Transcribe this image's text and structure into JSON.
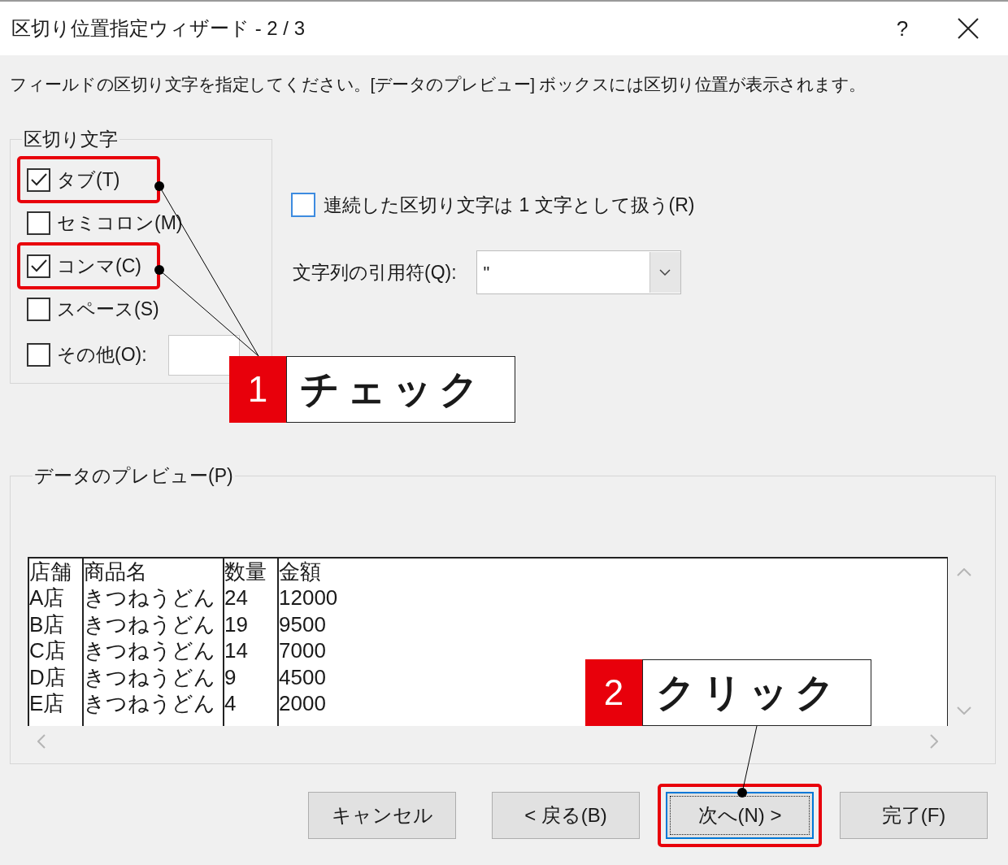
{
  "window": {
    "title": "区切り位置指定ウィザード - 2 / 3",
    "help": "?"
  },
  "instruction": "フィールドの区切り文字を指定してください。[データのプレビュー] ボックスには区切り位置が表示されます。",
  "delimiters": {
    "label": "区切り文字",
    "items": [
      {
        "label": "タブ(T)",
        "checked": true,
        "highlighted": true,
        "kind": "plain"
      },
      {
        "label": "セミコロン(M)",
        "checked": false,
        "highlighted": false,
        "kind": "plain"
      },
      {
        "label": "コンマ(C)",
        "checked": true,
        "highlighted": true,
        "kind": "plain"
      },
      {
        "label": "スペース(S)",
        "checked": false,
        "highlighted": false,
        "kind": "plain"
      },
      {
        "label": "その他(O):",
        "checked": false,
        "highlighted": false,
        "kind": "with_field"
      }
    ]
  },
  "options": {
    "consecutive": {
      "label": "連続した区切り文字は 1 文字として扱う(R)",
      "checked": false
    },
    "quote": {
      "label": "文字列の引用符(Q):",
      "value": "\""
    }
  },
  "preview": {
    "label": "データのプレビュー(P)",
    "rows": [
      [
        "店舗",
        "商品名",
        "数量",
        "金額"
      ],
      [
        "A店",
        "きつねうどん",
        "24",
        "12000"
      ],
      [
        "B店",
        "きつねうどん",
        "19",
        "9500"
      ],
      [
        "C店",
        "きつねうどん",
        "14",
        "7000"
      ],
      [
        "D店",
        "きつねうどん",
        "9",
        "4500"
      ],
      [
        "E店",
        "きつねうどん",
        "4",
        "2000"
      ]
    ]
  },
  "buttons": [
    {
      "label": "キャンセル",
      "highlighted": false,
      "focused": false
    },
    {
      "label": "< 戻る(B)",
      "highlighted": false,
      "focused": false
    },
    {
      "label": "次へ(N) >",
      "highlighted": true,
      "focused": true
    },
    {
      "label": "完了(F)",
      "highlighted": false,
      "focused": false
    }
  ],
  "annotations": [
    {
      "number": "1",
      "text": "チェック"
    },
    {
      "number": "2",
      "text": "クリック"
    }
  ]
}
